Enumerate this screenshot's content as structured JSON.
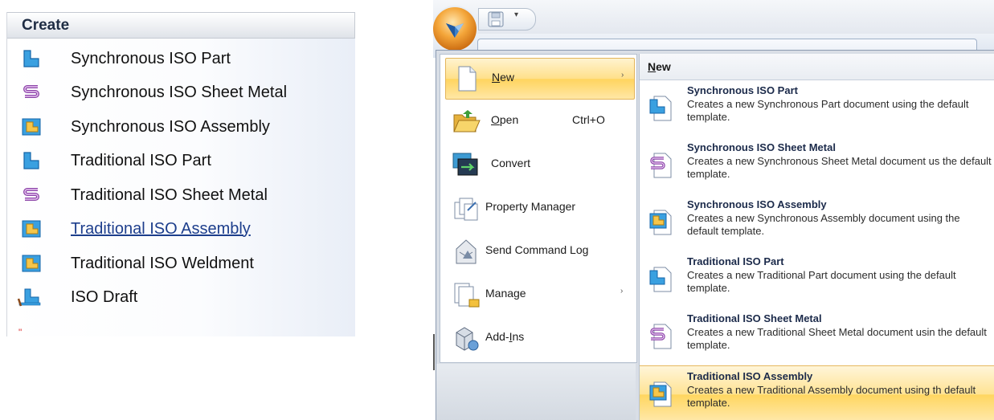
{
  "create_panel": {
    "header": "Create",
    "items": [
      {
        "label": "Synchronous ISO Part",
        "icon": "part-icon"
      },
      {
        "label": "Synchronous ISO Sheet Metal",
        "icon": "sheet-metal-icon"
      },
      {
        "label": "Synchronous ISO Assembly",
        "icon": "assembly-icon"
      },
      {
        "label": "Traditional ISO Part",
        "icon": "part-icon"
      },
      {
        "label": "Traditional ISO Sheet Metal",
        "icon": "sheet-metal-icon"
      },
      {
        "label": "Traditional ISO Assembly",
        "icon": "assembly-icon"
      },
      {
        "label": "Traditional ISO Weldment",
        "icon": "weldment-icon"
      },
      {
        "label": "ISO Draft",
        "icon": "draft-icon"
      }
    ],
    "footer_mark": "\""
  },
  "app_menu": {
    "qat_dropdown": "▾",
    "left_items": [
      {
        "label_u": "N",
        "label_rest": "ew",
        "shortcut": "",
        "arrow": "›",
        "icon": "new-document-icon"
      },
      {
        "label_u": "O",
        "label_rest": "pen",
        "shortcut": "Ctrl+O",
        "arrow": "",
        "icon": "open-folder-icon"
      },
      {
        "label_u": "",
        "label_rest": "Convert",
        "shortcut": "",
        "arrow": "",
        "icon": "convert-icon"
      },
      {
        "label_u": "",
        "label_rest": "Property Manager",
        "shortcut": "",
        "arrow": "",
        "icon": "property-manager-icon"
      },
      {
        "label_u": "",
        "label_rest": "Send Command Log",
        "shortcut": "",
        "arrow": "",
        "icon": "send-command-log-icon"
      },
      {
        "label_u": "",
        "label_rest": "Manage",
        "shortcut": "",
        "arrow": "›",
        "icon": "manage-icon"
      },
      {
        "label_u": "",
        "label_pre": "Add-",
        "label_u2": "I",
        "label_rest": "ns",
        "shortcut": "",
        "arrow": "",
        "icon": "add-ins-icon"
      }
    ],
    "submenu": {
      "header_u": "N",
      "header_rest": "ew",
      "items": [
        {
          "title": "Synchronous ISO Part",
          "desc": "Creates a new Synchronous Part document using the default template.",
          "icon": "part-icon"
        },
        {
          "title": "Synchronous ISO Sheet Metal",
          "desc": "Creates a new Synchronous Sheet Metal document us the default template.",
          "icon": "sheet-metal-icon"
        },
        {
          "title": "Synchronous ISO Assembly",
          "desc": "Creates a new Synchronous Assembly document using the default template.",
          "icon": "assembly-icon"
        },
        {
          "title": "Traditional ISO Part",
          "desc": "Creates a new Traditional Part document using the default template.",
          "icon": "part-icon"
        },
        {
          "title": "Traditional ISO Sheet Metal",
          "desc": "Creates a new Traditional Sheet Metal document usin the default template.",
          "icon": "sheet-metal-icon"
        },
        {
          "title": "Traditional ISO Assembly",
          "desc": "Creates a new Traditional Assembly document using th default template.",
          "icon": "assembly-icon"
        }
      ]
    }
  }
}
